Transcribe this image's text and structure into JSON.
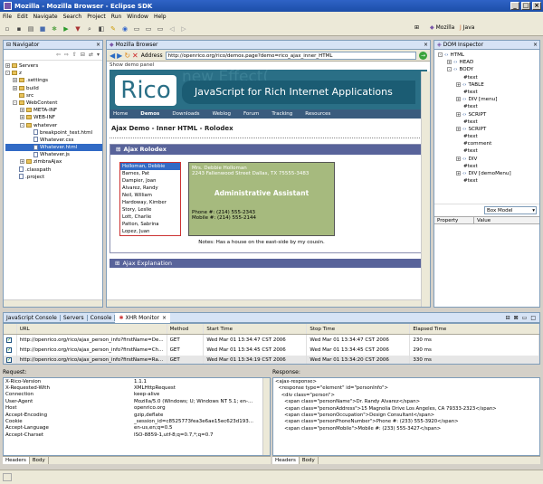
{
  "window": {
    "title": "Mozilla - Mozilla Browser - Eclipse SDK"
  },
  "menu": [
    "File",
    "Edit",
    "Navigate",
    "Search",
    "Project",
    "Run",
    "Window",
    "Help"
  ],
  "perspectives": {
    "mozilla": "Mozilla",
    "java": "Java"
  },
  "navigator": {
    "title": "Navigator",
    "rows": [
      {
        "label": "Servers",
        "kind": "folder",
        "toggle": "+",
        "level": 0
      },
      {
        "label": "z",
        "kind": "folder",
        "toggle": "-",
        "level": 0
      },
      {
        "label": ".settings",
        "kind": "folder",
        "toggle": "+",
        "level": 1
      },
      {
        "label": "build",
        "kind": "folder",
        "toggle": "+",
        "level": 1
      },
      {
        "label": "src",
        "kind": "folder",
        "toggle": "",
        "level": 1
      },
      {
        "label": "WebContent",
        "kind": "folder",
        "toggle": "-",
        "level": 1
      },
      {
        "label": "META-INF",
        "kind": "folder",
        "toggle": "+",
        "level": 2
      },
      {
        "label": "WEB-INF",
        "kind": "folder",
        "toggle": "+",
        "level": 2
      },
      {
        "label": "whatever",
        "kind": "folder",
        "toggle": "-",
        "level": 2
      },
      {
        "label": "breakpoint_test.html",
        "kind": "file",
        "toggle": "",
        "level": 3
      },
      {
        "label": "Whatever.css",
        "kind": "file",
        "toggle": "",
        "level": 3
      },
      {
        "label": "Whatever.html",
        "kind": "file",
        "toggle": "",
        "level": 3,
        "selected": true
      },
      {
        "label": "Whatever.js",
        "kind": "file",
        "toggle": "",
        "level": 3
      },
      {
        "label": "zimbraAjax",
        "kind": "folder",
        "toggle": "+",
        "level": 2
      },
      {
        "label": ".classpath",
        "kind": "file",
        "toggle": "",
        "level": 1
      },
      {
        "label": ".project",
        "kind": "file",
        "toggle": "",
        "level": 1
      }
    ]
  },
  "browser": {
    "tab": "Mozilla Browser",
    "address_label": "Address",
    "url": "http://openrico.org/rico/demos.page?demo=rico_ajax_inner_HTML",
    "show_panel": "Show demo panel",
    "site": {
      "logo": "Rico",
      "tagline": "JavaScript for Rich Internet Applications",
      "watermark": "new Effect(",
      "nav": [
        "Home",
        "Demos",
        "Downloads",
        "Weblog",
        "Forum",
        "Tracking",
        "Resources"
      ],
      "page_title": "Ajax Demo - Inner HTML - Rolodex",
      "panel_title": "Ajax Rolodex",
      "names": [
        "Holloman, Debbie",
        "Barnes, Pat",
        "Dampier, Joan",
        "Alvarez, Randy",
        "Neil, William",
        "Hardoway, Kimber",
        "Story, Leslie",
        "Lott, Charlie",
        "Patton, Sabrina",
        "Lopez, Juan"
      ],
      "card": {
        "name": "Mrs. Debbie Holloman",
        "address": "2243 Fallenwood Street Dallas, TX 75555-3483",
        "role": "Administrative Assistant",
        "phone": "Phone #: (214) 555-2343",
        "mobile": "Mobile #: (214) 555-2144"
      },
      "note": "Notes: Has a house on the east-side by my cousin.",
      "next_panel": "Ajax Explanation"
    }
  },
  "dom": {
    "title": "DOM Inspector",
    "rows": [
      {
        "t": "HTML",
        "toggle": "-",
        "level": 0,
        "tag": true
      },
      {
        "t": "HEAD",
        "toggle": "+",
        "level": 1,
        "tag": true
      },
      {
        "t": "BODY",
        "toggle": "-",
        "level": 1,
        "tag": true
      },
      {
        "t": "#text",
        "toggle": "",
        "level": 2,
        "tag": false
      },
      {
        "t": "TABLE",
        "toggle": "+",
        "level": 2,
        "tag": true
      },
      {
        "t": "#text",
        "toggle": "",
        "level": 2,
        "tag": false
      },
      {
        "t": "DIV [menu]",
        "toggle": "+",
        "level": 2,
        "tag": true
      },
      {
        "t": "#text",
        "toggle": "",
        "level": 2,
        "tag": false
      },
      {
        "t": "SCRIPT",
        "toggle": "+",
        "level": 2,
        "tag": true
      },
      {
        "t": "#text",
        "toggle": "",
        "level": 2,
        "tag": false
      },
      {
        "t": "SCRIPT",
        "toggle": "+",
        "level": 2,
        "tag": true
      },
      {
        "t": "#text",
        "toggle": "",
        "level": 2,
        "tag": false
      },
      {
        "t": "#comment",
        "toggle": "",
        "level": 2,
        "tag": false
      },
      {
        "t": "#text",
        "toggle": "",
        "level": 2,
        "tag": false
      },
      {
        "t": "DIV",
        "toggle": "+",
        "level": 2,
        "tag": true
      },
      {
        "t": "#text",
        "toggle": "",
        "level": 2,
        "tag": false
      },
      {
        "t": "DIV [demoMenu]",
        "toggle": "+",
        "level": 2,
        "tag": true
      },
      {
        "t": "#text",
        "toggle": "",
        "level": 2,
        "tag": false
      }
    ],
    "select": "Box Model",
    "col_property": "Property",
    "col_value": "Value"
  },
  "bottom_tabs": [
    "JavaScript Console",
    "Servers",
    "Console"
  ],
  "xhr": {
    "tab": "XHR Monitor",
    "headers": [
      "",
      "URL",
      "Method",
      "Start Time",
      "Stop Time",
      "Elapsed Time"
    ],
    "rows": [
      {
        "url": "http://openrico.org/rico/ajax_person_info?firstName=De...",
        "method": "GET",
        "start": "Wed Mar 01 13:34:47 CST 2006",
        "stop": "Wed Mar 01 13:34:47 CST 2006",
        "elapsed": "230 ms"
      },
      {
        "url": "http://openrico.org/rico/ajax_person_info?firstName=Ch...",
        "method": "GET",
        "start": "Wed Mar 01 13:34:45 CST 2006",
        "stop": "Wed Mar 01 13:34:45 CST 2006",
        "elapsed": "290 ms"
      },
      {
        "url": "http://openrico.org/rico/ajax_person_info?firstName=Ra...",
        "method": "GET",
        "start": "Wed Mar 01 13:34:19 CST 2006",
        "stop": "Wed Mar 01 13:34:20 CST 2006",
        "elapsed": "330 ms"
      }
    ]
  },
  "request": {
    "label": "Request:",
    "headers": [
      [
        "X-Rico-Version",
        "1.1.1"
      ],
      [
        "X-Requested-With",
        "XMLHttpRequest"
      ],
      [
        "Connection",
        "keep-alive"
      ],
      [
        "User-Agent",
        "Mozilla/5.0 (Windows; U; Windows NT 5.1; en-..."
      ],
      [
        "Host",
        "openrico.org"
      ],
      [
        "Accept-Encoding",
        "gzip,deflate"
      ],
      [
        "Cookie",
        "_session_id=c8525773fea3e6ae15ec623d193..."
      ],
      [
        "Accept-Language",
        "en-us,en;q=0.5"
      ],
      [
        "Accept-Charset",
        "ISO-8859-1,utf-8;q=0.7,*;q=0.7"
      ]
    ],
    "tabs": [
      "Headers",
      "Body"
    ]
  },
  "response": {
    "label": "Response:",
    "lines": [
      "<ajax-response>",
      "  <response type=\"element\" id=\"personInfo\">",
      "    <div class=\"person\">",
      "      <span class=\"personName\">Dr. Randy Alvarez</span>",
      "      <span class=\"personAddress\">15 Magnolia Drive Los Angeles, CA 79333-2323</span>",
      "      <span class=\"personOccupation\">Design Consultant</span>",
      "      <span class=\"personPhoneNumber\">Phone #: (233) 555-3920</span>",
      "      <span class=\"personMobile\">Mobile #: (233) 555-3427</span>"
    ],
    "tabs": [
      "Headers",
      "Body"
    ]
  }
}
